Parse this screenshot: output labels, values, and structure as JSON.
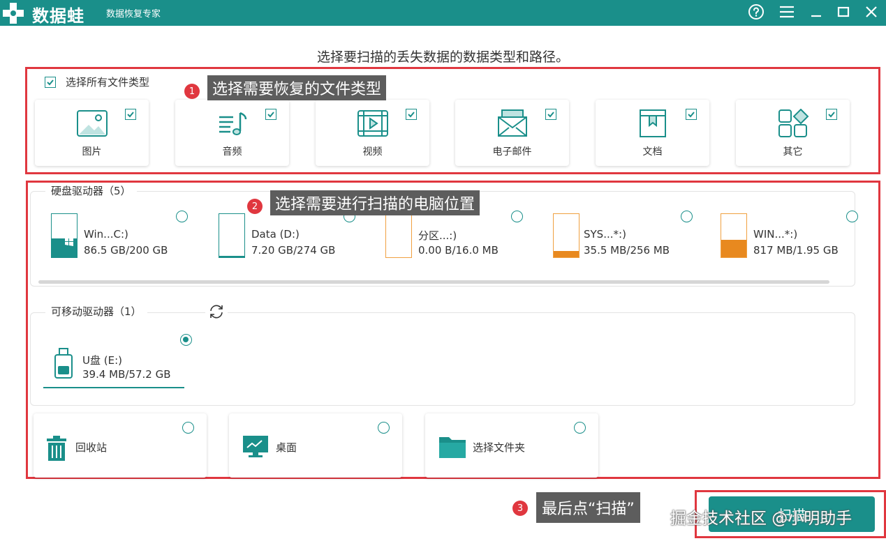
{
  "app": {
    "logo_text": "数据蛙",
    "subtitle": "数据恢复专家"
  },
  "page_title": "选择要扫描的丢失数据的数据类型和路径。",
  "file_types": {
    "select_all_label": "选择所有文件类型",
    "items": [
      {
        "label": "图片",
        "icon": "image-icon",
        "checked": true
      },
      {
        "label": "音频",
        "icon": "music-icon",
        "checked": true
      },
      {
        "label": "视频",
        "icon": "video-icon",
        "checked": true
      },
      {
        "label": "电子邮件",
        "icon": "mail-icon",
        "checked": true
      },
      {
        "label": "文档",
        "icon": "document-icon",
        "checked": true
      },
      {
        "label": "其它",
        "icon": "apps-icon",
        "checked": true
      }
    ]
  },
  "annotations": {
    "step1": {
      "num": "1",
      "text": "选择需要恢复的文件类型"
    },
    "step2": {
      "num": "2",
      "text": "选择需要进行扫描的电脑位置"
    },
    "step3": {
      "num": "3",
      "text": "最后点“扫描”"
    }
  },
  "hard_drives": {
    "title": "硬盘驱动器（5）",
    "items": [
      {
        "name": "Win...C:)",
        "size": "86.5 GB/200 GB",
        "used_fraction": 0.43,
        "color": "teal"
      },
      {
        "name": "Data (D:)",
        "size": "7.20 GB/274 GB",
        "used_fraction": 0.03,
        "color": "teal"
      },
      {
        "name": "分区...:)",
        "size": "0.00  B/16.0 MB",
        "used_fraction": 0.0,
        "color": "orange"
      },
      {
        "name": "SYS...*:)",
        "size": "35.5 MB/256 MB",
        "used_fraction": 0.14,
        "color": "orange"
      },
      {
        "name": "WIN...*:)",
        "size": "817 MB/1.95 GB",
        "used_fraction": 0.41,
        "color": "orange"
      }
    ]
  },
  "removable": {
    "title": "可移动驱动器（1）",
    "items": [
      {
        "name": "U盘 (E:)",
        "size": "39.4 MB/57.2 GB",
        "selected": true
      }
    ]
  },
  "locations": [
    {
      "label": "回收站",
      "icon": "trash-icon"
    },
    {
      "label": "桌面",
      "icon": "desktop-icon"
    },
    {
      "label": "选择文件夹",
      "icon": "folder-icon"
    }
  ],
  "scan_button": "扫描",
  "watermark": "掘金技术社区 @小明助手",
  "colors": {
    "accent": "#1a8f8a",
    "highlight": "#e0373f",
    "callout": "#5d5d5d",
    "orange": "#e8891f"
  }
}
